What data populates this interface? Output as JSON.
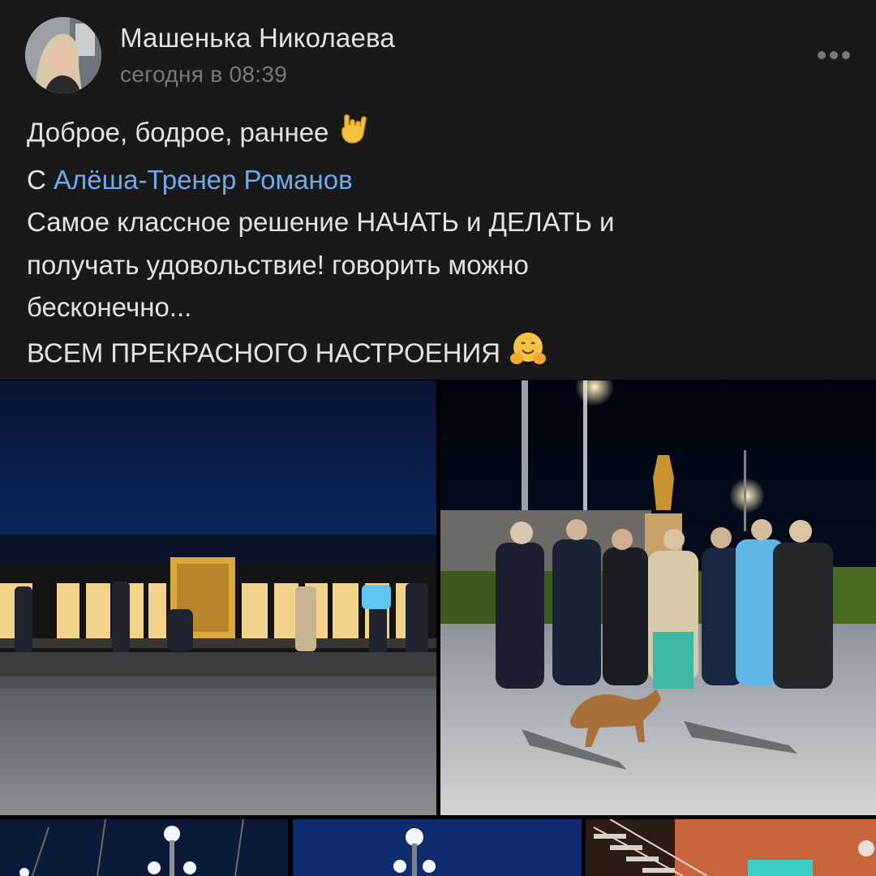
{
  "post": {
    "author_name": "Машенька Николаева",
    "time": "сегодня в 08:39",
    "text": {
      "line1": "Доброе, бодрое, раннее",
      "line2_prefix": "С ",
      "line2_mention": "Алёша-Тренер Романов",
      "line3": "Самое классное решение НАЧАТЬ и ДЕЛАТЬ и",
      "line4": "получать удовольствие! говорить можно",
      "line5": "бесконечно...",
      "line6": "ВСЕМ ПРЕКРАСНОГО НАСТРОЕНИЯ"
    },
    "emojis": [
      "hand-rock-emoji",
      "hugging-face-emoji"
    ]
  },
  "photos": [
    {
      "name": "photo-city-sign-night"
    },
    {
      "name": "photo-group-with-dog"
    },
    {
      "name": "photo-street-lamps"
    },
    {
      "name": "photo-lamp-sky"
    },
    {
      "name": "photo-stairs-interior"
    }
  ],
  "colors": {
    "background": "#19191a",
    "text": "#e1e3e6",
    "secondary_text": "#76787a",
    "link": "#71aaeb"
  },
  "icons": {
    "more": "more-dots-icon"
  }
}
